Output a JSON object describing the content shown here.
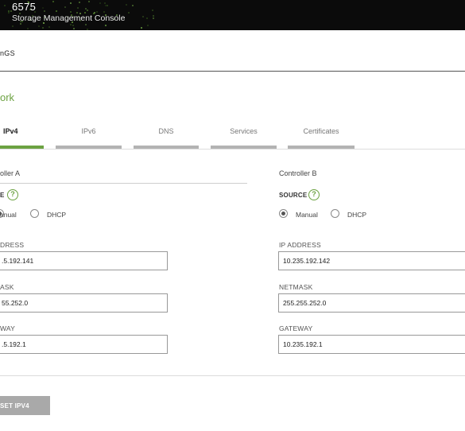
{
  "banner": {
    "model": "6575",
    "product": "Storage Management Console"
  },
  "breadcrumb": "nGS",
  "section_title": "ork",
  "tabs": [
    {
      "label": "IPv4",
      "active": true
    },
    {
      "label": "IPv6",
      "active": false
    },
    {
      "label": "DNS",
      "active": false
    },
    {
      "label": "Services",
      "active": false
    },
    {
      "label": "Certificates",
      "active": false
    }
  ],
  "controller_a": {
    "title": "oller A",
    "source_label": "E",
    "help_glyph": "?",
    "option_manual": "anual",
    "option_dhcp": "DHCP",
    "selected": "manual",
    "ip_label": "DRESS",
    "ip_value": ".5.192.141",
    "netmask_label": "ASK",
    "netmask_value": "55.252.0",
    "gateway_label": "WAY",
    "gateway_value": ".5.192.1"
  },
  "controller_b": {
    "title": "Controller B",
    "source_label": "SOURCE",
    "help_glyph": "?",
    "option_manual": "Manual",
    "option_dhcp": "DHCP",
    "selected": "manual",
    "ip_label": "IP ADDRESS",
    "ip_value": "10.235.192.142",
    "netmask_label": "NETMASK",
    "netmask_value": "255.255.252.0",
    "gateway_label": "GATEWAY",
    "gateway_value": "10.235.192.1"
  },
  "reset_button": "SET IPV4",
  "colors": {
    "accent": "#6ca242",
    "banner": "#0b0b0b",
    "tab_inactive": "#b3b3b3",
    "button": "#a9a9a9"
  }
}
